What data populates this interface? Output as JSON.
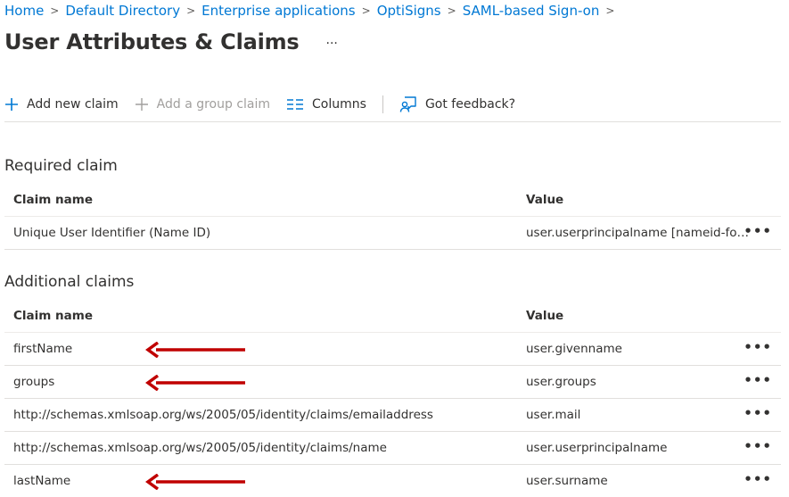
{
  "breadcrumb": {
    "items": [
      "Home",
      "Default Directory",
      "Enterprise applications",
      "OptiSigns",
      "SAML-based Sign-on"
    ],
    "separator": ">"
  },
  "page": {
    "title": "User Attributes & Claims",
    "more": "···"
  },
  "toolbar": {
    "add_claim": "Add new claim",
    "add_group_claim": "Add a group claim",
    "columns": "Columns",
    "feedback": "Got feedback?"
  },
  "required": {
    "title": "Required claim",
    "headers": {
      "name": "Claim name",
      "value": "Value"
    },
    "rows": [
      {
        "name": "Unique User Identifier (Name ID)",
        "value": "user.userprincipalname [nameid-for..."
      }
    ]
  },
  "additional": {
    "title": "Additional claims",
    "headers": {
      "name": "Claim name",
      "value": "Value"
    },
    "rows": [
      {
        "name": "firstName",
        "value": "user.givenname"
      },
      {
        "name": "groups",
        "value": "user.groups"
      },
      {
        "name": "http://schemas.xmlsoap.org/ws/2005/05/identity/claims/emailaddress",
        "value": "user.mail"
      },
      {
        "name": "http://schemas.xmlsoap.org/ws/2005/05/identity/claims/name",
        "value": "user.userprincipalname"
      },
      {
        "name": "lastName",
        "value": "user.surname"
      }
    ]
  },
  "row_more": "•••",
  "colors": {
    "link": "#0078d4",
    "annotation_arrow": "#c00000",
    "text": "#323130"
  },
  "icons": [
    "plus-icon",
    "columns-icon",
    "feedback-icon",
    "ellipsis-icon",
    "chevron-right-icon",
    "red-arrow-annotation"
  ]
}
